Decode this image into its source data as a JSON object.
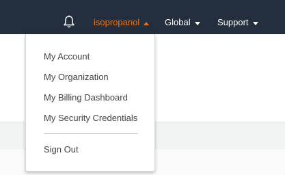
{
  "header": {
    "bell_icon": "bell-icon",
    "account_label": "isopropanol",
    "account_color": "#ec7211",
    "account_caret": "caret-up-icon",
    "region_label": "Global",
    "region_caret": "caret-down-icon",
    "support_label": "Support",
    "support_caret": "caret-down-icon",
    "bar_color": "#232f3e"
  },
  "account_menu": {
    "items": [
      {
        "label": "My Account"
      },
      {
        "label": "My Organization"
      },
      {
        "label": "My Billing Dashboard"
      },
      {
        "label": "My Security Credentials"
      }
    ],
    "sign_out_label": "Sign Out"
  }
}
